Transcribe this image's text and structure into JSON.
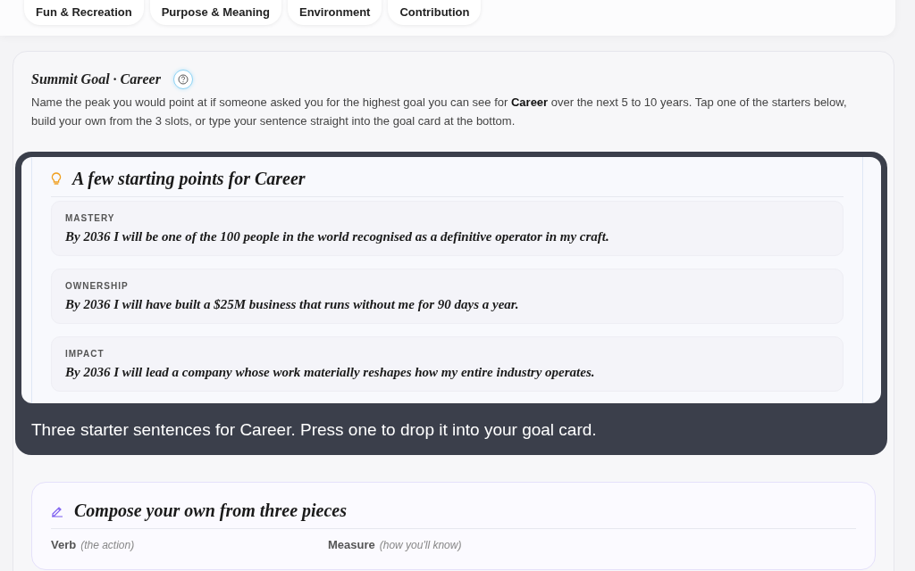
{
  "chips": [
    {
      "label": "Fun & Recreation"
    },
    {
      "label": "Purpose & Meaning"
    },
    {
      "label": "Environment"
    },
    {
      "label": "Contribution"
    }
  ],
  "summit": {
    "title": "Summit Goal · Career",
    "description": "Name the peak you would point at if someone asked you for the highest goal you can see for **Career** over the next 5 to 10 years. Tap one of the starters below, build your own from the 3 slots, or type your sentence straight into the goal card at the bottom."
  },
  "starters": {
    "heading": "A few starting points for Career",
    "items": [
      {
        "category": "MASTERY",
        "sentence": "By 2036 I will be one of the 100 people in the world recognised as a definitive operator in my craft."
      },
      {
        "category": "OWNERSHIP",
        "sentence": "By 2036 I will have built a $25M business that runs without me for 90 days a year."
      },
      {
        "category": "IMPACT",
        "sentence": "By 2036 I will lead a company whose work materially reshapes how my entire industry operates."
      }
    ]
  },
  "tour": {
    "caption": "Three starter sentences for Career. Press one to drop it into your goal card."
  },
  "compose": {
    "heading": "Compose your own from three pieces",
    "fields": [
      {
        "label": "Verb",
        "hint": "(the action)"
      },
      {
        "label": "Measure",
        "hint": "(how you'll know)"
      }
    ]
  }
}
